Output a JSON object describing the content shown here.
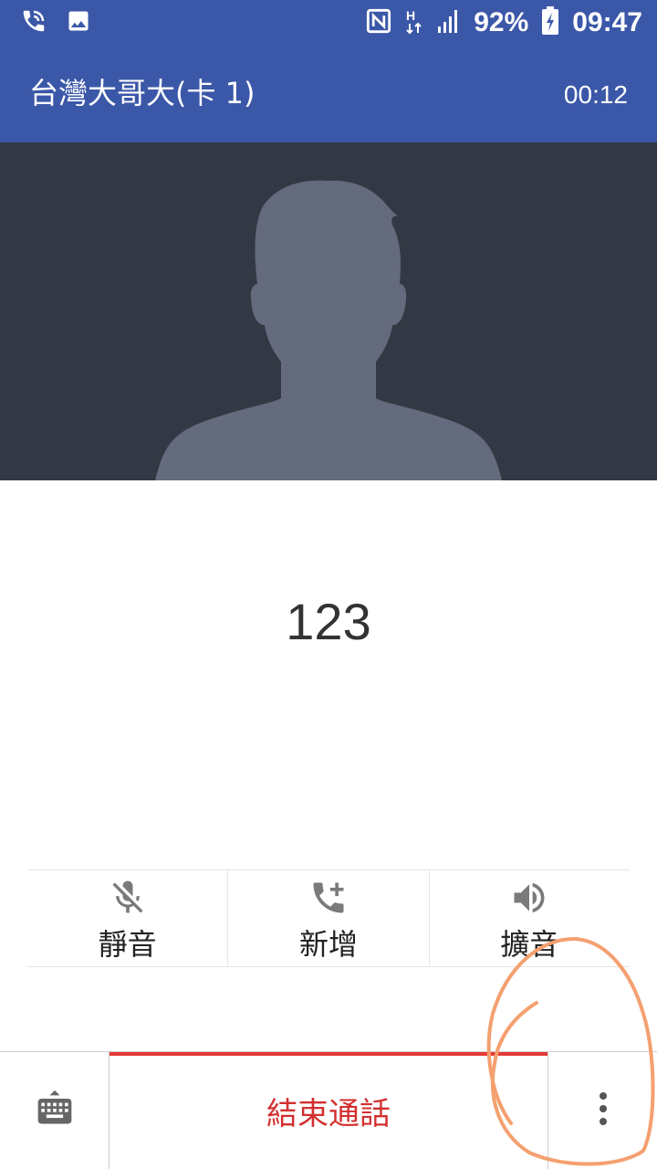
{
  "status_bar": {
    "battery": "92%",
    "time": "09:47",
    "icons": [
      "phone-call-icon",
      "image-icon",
      "nfc-icon",
      "h-plus-data-icon",
      "signal-icon",
      "battery-charging-icon"
    ]
  },
  "call": {
    "carrier": "台灣大哥大(卡 1)",
    "duration": "00:12",
    "number": "123"
  },
  "actions": [
    {
      "label": "靜音",
      "icon": "mic-off-icon"
    },
    {
      "label": "新增",
      "icon": "add-call-icon"
    },
    {
      "label": "擴音",
      "icon": "speaker-icon"
    }
  ],
  "bottom": {
    "end_call_label": "結束通話",
    "keyboard_icon": "keyboard-icon",
    "more_icon": "more-vert-icon"
  },
  "colors": {
    "app_bar": "#3b57a8",
    "photo_bg": "#333944",
    "silhouette": "#646b7c",
    "end_call": "#d32f2f",
    "annotation": "#f4a070"
  }
}
